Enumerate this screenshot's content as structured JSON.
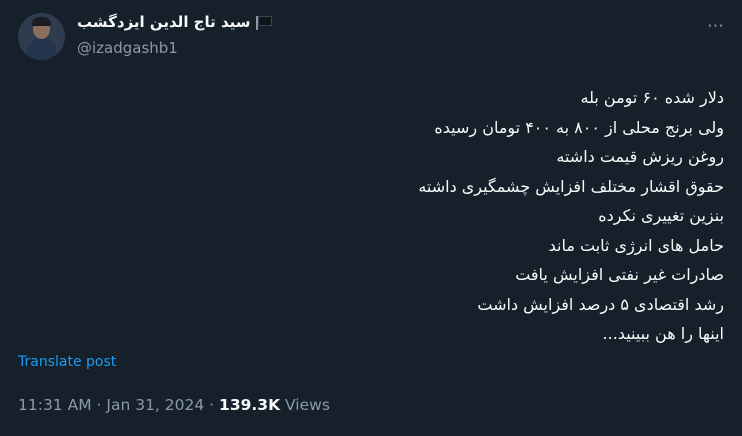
{
  "author": {
    "display_name": "سید تاج الدین ایزدگشب",
    "handle": "@izadgashb1",
    "flag_icon": "black-flag-icon",
    "avatar_icon": "profile-photo"
  },
  "more_icon": "more-horizontal-icon",
  "more_glyph": "⋯",
  "tweet": {
    "lines": [
      "دلار شده ۶۰ تومن بله",
      "ولی برنج محلی از ۸۰۰ به ۴۰۰ تومان رسیده",
      "روغن ریزش قیمت داشته",
      "حقوق اقشار مختلف افزایش چشمگیری داشته",
      "بنزین تغییری نکرده",
      "حامل های انرژی ثابت ماند",
      "صادرات غیر نفتی افزایش یافت",
      "رشد اقتصادی ۵ درصد افزایش داشت",
      "اینها را هن ببینید..."
    ]
  },
  "translate_label": "Translate post",
  "meta": {
    "time": "11:31 AM",
    "separator": "·",
    "date": "Jan 31, 2024",
    "views_count": "139.3K",
    "views_label": "Views"
  },
  "colors": {
    "background": "#15202b",
    "text": "#f7f9f9",
    "secondary": "#8b98a5",
    "link": "#1d9bf0"
  }
}
